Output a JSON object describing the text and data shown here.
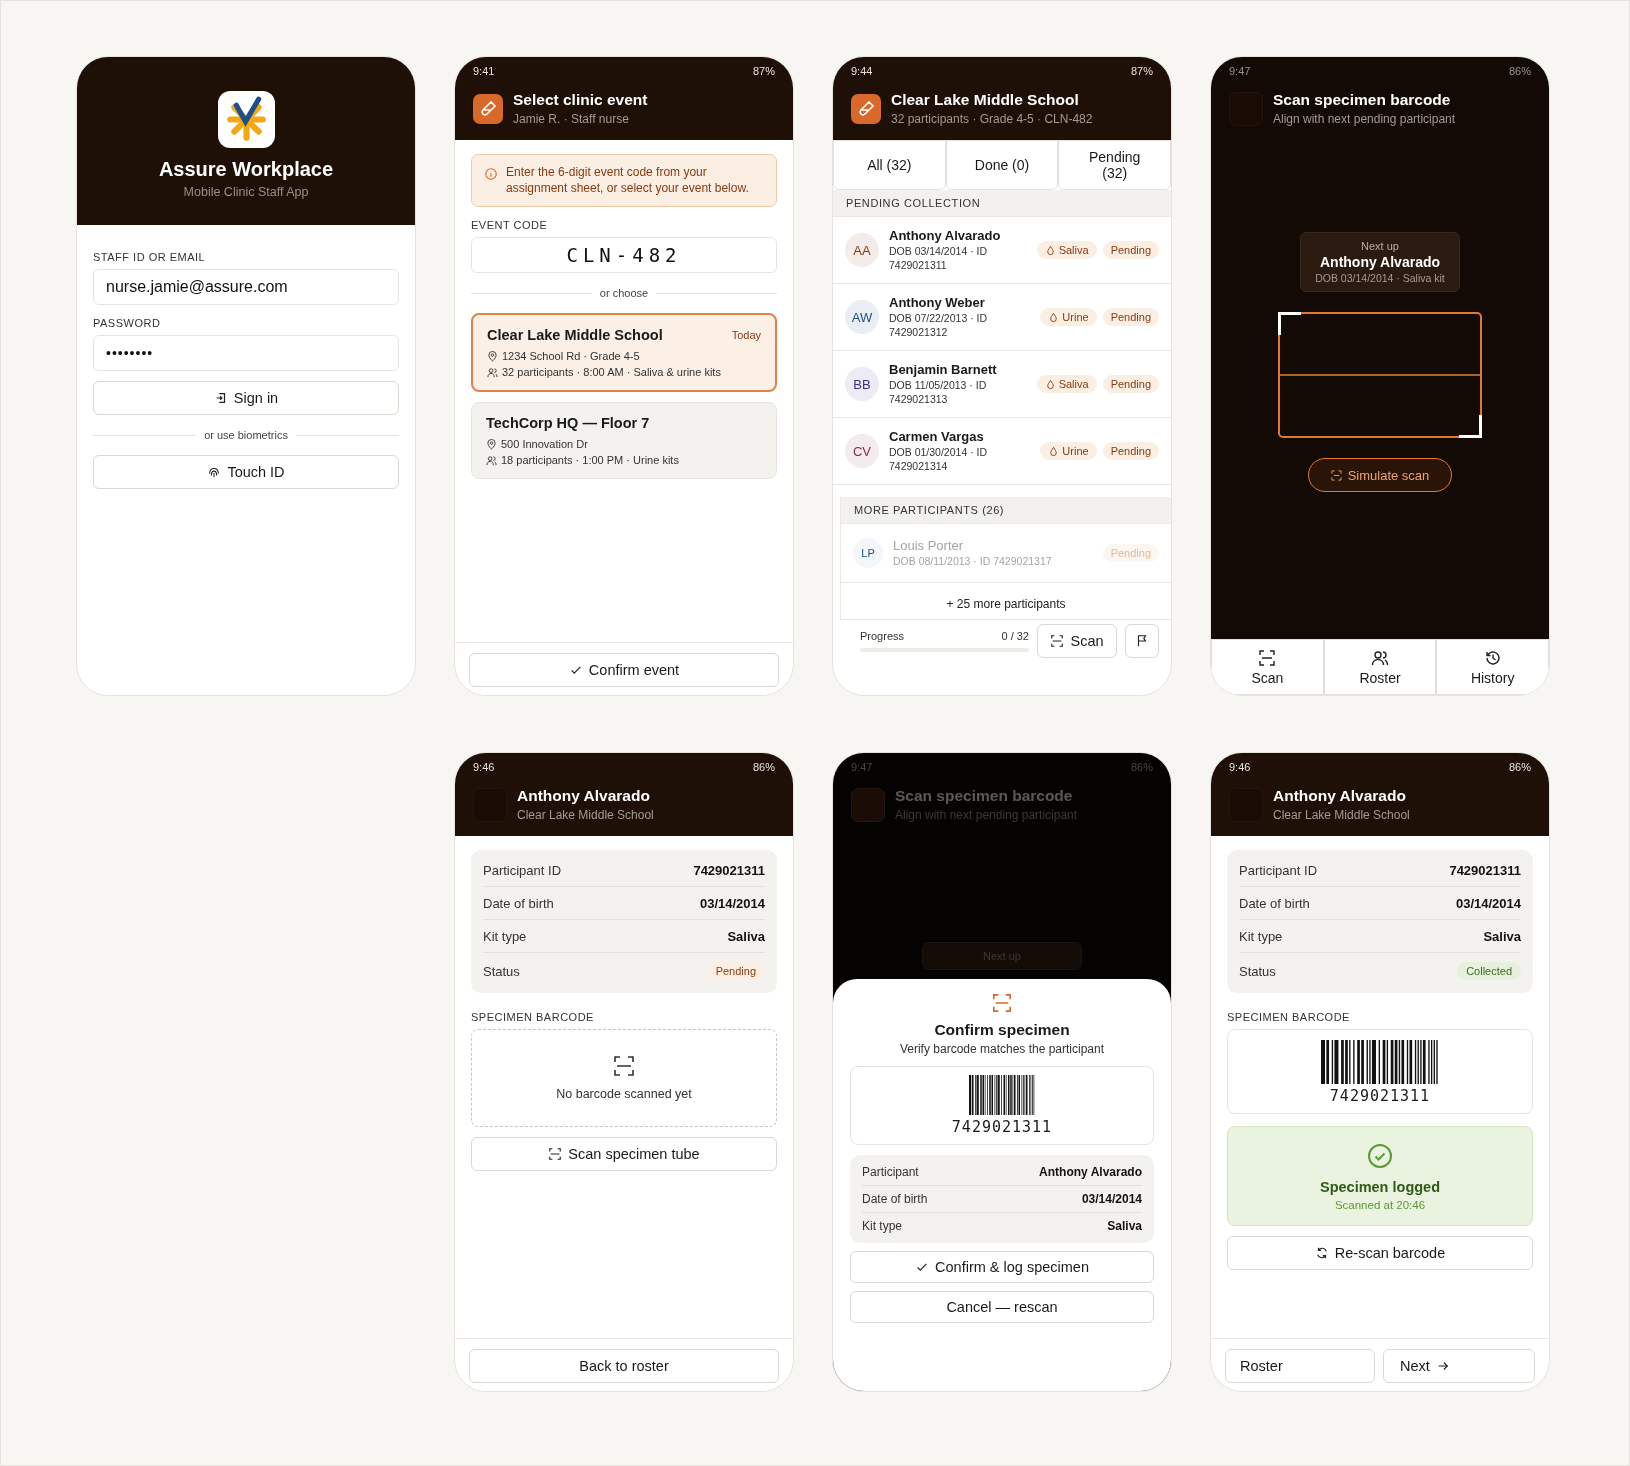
{
  "screens": [
    {
      "kind": "login",
      "app_title": "Assure Workplace",
      "app_subtitle": "Mobile Clinic Staff App",
      "fields": [
        {
          "label": "STAFF ID OR EMAIL",
          "value": "nurse.jamie@assure.com"
        },
        {
          "label": "PASSWORD",
          "value": "••••••••"
        }
      ],
      "sign_in": "Sign in",
      "divider": "or use biometrics",
      "biometric_button": "Touch ID"
    },
    {
      "kind": "event_select",
      "time": "9:41",
      "battery": "87%",
      "title": "Select clinic event",
      "subtitle": "Jamie R. · Staff nurse",
      "notice": "Enter the 6-digit event code from your assignment sheet, or select your event below.",
      "code_label": "EVENT CODE",
      "code": "CLN-482",
      "divider": "or choose",
      "events": [
        {
          "name": "Clear Lake Middle School",
          "badge": "Today",
          "address": "1234 School Rd · Grade 4-5",
          "details": "32 participants · 8:00 AM · Saliva & urine kits",
          "selected": true
        },
        {
          "name": "TechCorp HQ — Floor 7",
          "address": "500 Innovation Dr",
          "details": "18 participants · 1:00 PM · Urine kits",
          "selected": false
        }
      ],
      "confirm": "Confirm event"
    },
    {
      "kind": "roster",
      "time": "9:44",
      "battery": "87%",
      "title": "Clear Lake Middle School",
      "subtitle": "32 participants · Grade 4-5 · CLN-482",
      "tabs": [
        "All (32)",
        "Done (0)",
        "Pending (32)"
      ],
      "section": "PENDING COLLECTION",
      "participants": [
        {
          "initials": "AA",
          "name": "Anthony Alvarado",
          "meta": "DOB 03/14/2014 · ID 7429021311",
          "kit": "Saliva",
          "status": "Pending",
          "color": "#8a3a10"
        },
        {
          "initials": "AW",
          "name": "Anthony Weber",
          "meta": "DOB 07/22/2013 · ID 7429021312",
          "kit": "Urine",
          "status": "Pending",
          "color": "#1f4f8a"
        },
        {
          "initials": "BB",
          "name": "Benjamin Barnett",
          "meta": "DOB 11/05/2013 · ID 7429021313",
          "kit": "Saliva",
          "status": "Pending",
          "color": "#3b2f8f"
        },
        {
          "initials": "CV",
          "name": "Carmen Vargas",
          "meta": "DOB 01/30/2014 · ID 7429021314",
          "kit": "Urine",
          "status": "Pending",
          "color": "#8a2a4a"
        }
      ],
      "more_section": "MORE PARTICIPANTS (26)",
      "more_participants": [
        {
          "initials": "LP",
          "name": "Louis Porter",
          "meta": "DOB 08/11/2013 · ID 7429021317",
          "status": "Pending",
          "color": "#1f4f8a"
        }
      ],
      "more_count": "+ 25 more participants",
      "progress_label": "Progress",
      "progress_count": "0 / 32",
      "level": 0,
      "scan": "Scan"
    },
    {
      "kind": "scanner",
      "time": "9:47",
      "battery": "86%",
      "title": "Scan specimen barcode",
      "subtitle": "Align with next pending participant",
      "next_label": "Next up",
      "next_name": "Anthony Alvarado",
      "next_details": "DOB 03/14/2014 · Saliva kit",
      "action": "Simulate scan",
      "nav": [
        {
          "label": "Scan",
          "kind": "scan"
        },
        {
          "label": "Roster",
          "kind": "people"
        },
        {
          "label": "History",
          "kind": "history"
        }
      ]
    },
    {
      "kind": "participant",
      "time": "9:46",
      "battery": "86%",
      "title": "Anthony Alvarado",
      "subtitle": "Clear Lake Middle School",
      "rows": [
        {
          "label": "Participant ID",
          "value": "7429021311"
        },
        {
          "label": "Date of birth",
          "value": "03/14/2014"
        },
        {
          "label": "Kit type",
          "value": "Saliva"
        }
      ],
      "status_label": "Status",
      "status": {
        "label": "Pending",
        "kind": "pending"
      },
      "barcode_label": "SPECIMEN BARCODE",
      "empty_barcode": "No barcode scanned yet",
      "action": {
        "label": "Scan specimen tube",
        "kind": "scan"
      },
      "footer": [
        {
          "label": "Back to roster",
          "kind": "plain"
        }
      ]
    },
    {
      "kind": "confirm",
      "time": "9:47",
      "battery": "86%",
      "title": "Scan specimen barcode",
      "subtitle": "Align with next pending participant",
      "next_label": "Next up",
      "sheet_title": "Confirm specimen",
      "sheet_subtitle": "Verify barcode matches the participant",
      "barcode": "7429021311",
      "rows": [
        {
          "label": "Participant",
          "value": "Anthony Alvarado"
        },
        {
          "label": "Date of birth",
          "value": "03/14/2014"
        },
        {
          "label": "Kit type",
          "value": "Saliva"
        }
      ],
      "confirm": "Confirm & log specimen",
      "cancel": "Cancel — rescan"
    },
    {
      "kind": "participant",
      "time": "9:46",
      "battery": "86%",
      "title": "Anthony Alvarado",
      "subtitle": "Clear Lake Middle School",
      "rows": [
        {
          "label": "Participant ID",
          "value": "7429021311"
        },
        {
          "label": "Date of birth",
          "value": "03/14/2014"
        },
        {
          "label": "Kit type",
          "value": "Saliva"
        }
      ],
      "status_label": "Status",
      "status": {
        "label": "Collected",
        "kind": "collected"
      },
      "barcode_label": "SPECIMEN BARCODE",
      "barcode": "7429021311",
      "logged_title": "Specimen logged",
      "logged_time": "Scanned at 20:46",
      "action": {
        "label": "Re-scan barcode",
        "kind": "rescan"
      },
      "footer": [
        {
          "label": "Roster",
          "kind": "plain"
        },
        {
          "label": "Next",
          "kind": "next"
        }
      ]
    }
  ]
}
